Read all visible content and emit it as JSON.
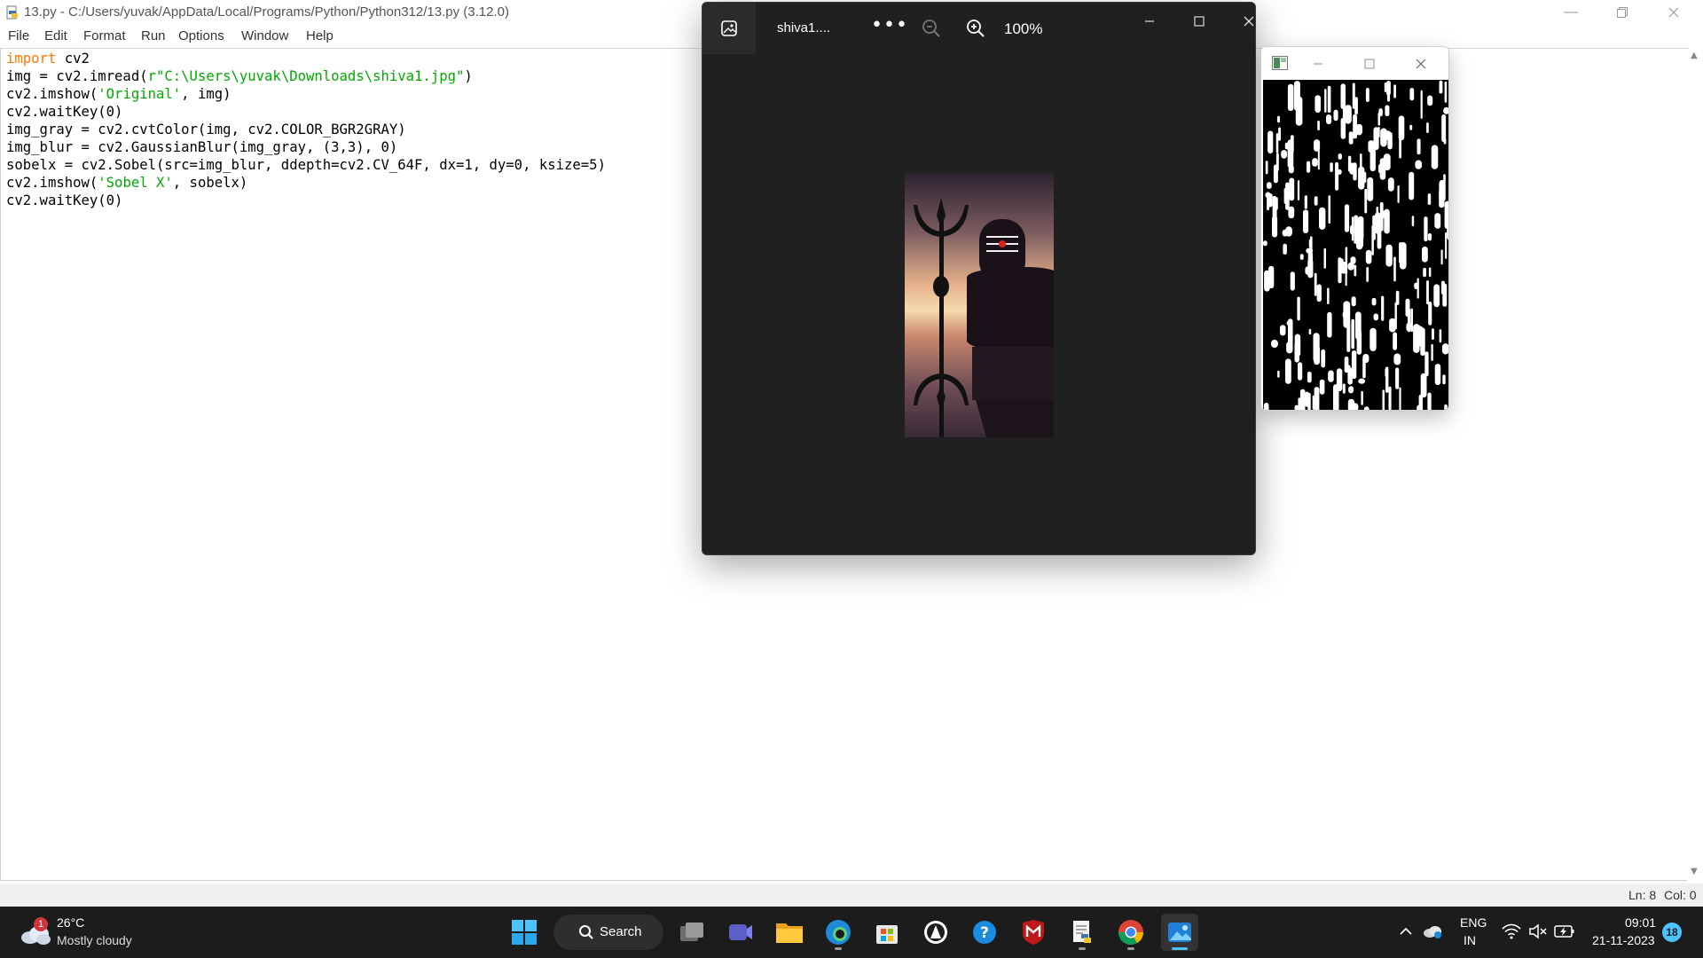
{
  "idle": {
    "title": "13.py - C:/Users/yuvak/AppData/Local/Programs/Python/Python312/13.py (3.12.0)",
    "menu": [
      "File",
      "Edit",
      "Format",
      "Run",
      "Options",
      "Window",
      "Help"
    ],
    "code": [
      [
        {
          "t": "import",
          "c": "kw"
        },
        {
          "t": " cv2",
          "c": ""
        }
      ],
      [
        {
          "t": "img = cv2.imread(",
          "c": ""
        },
        {
          "t": "r\"C:\\Users\\yuvak\\Downloads\\shiva1.jpg\"",
          "c": "st"
        },
        {
          "t": ")",
          "c": ""
        }
      ],
      [
        {
          "t": "cv2.imshow(",
          "c": ""
        },
        {
          "t": "'Original'",
          "c": "st"
        },
        {
          "t": ", img)",
          "c": ""
        }
      ],
      [
        {
          "t": "cv2.waitKey(0)",
          "c": ""
        }
      ],
      [
        {
          "t": "img_gray = cv2.cvtColor(img, cv2.COLOR_BGR2GRAY)",
          "c": ""
        }
      ],
      [
        {
          "t": "img_blur = cv2.GaussianBlur(img_gray, (3,3), 0)",
          "c": ""
        }
      ],
      [
        {
          "t": "sobelx = cv2.Sobel(src=img_blur, ddepth=cv2.CV_64F, dx=1, dy=0, ksize=5)",
          "c": ""
        }
      ],
      [
        {
          "t": "cv2.imshow(",
          "c": ""
        },
        {
          "t": "'Sobel X'",
          "c": "st"
        },
        {
          "t": ", sobelx)",
          "c": ""
        }
      ],
      [
        {
          "t": "cv2.waitKey(0)",
          "c": ""
        }
      ]
    ],
    "status": {
      "line": "Ln: 8",
      "col": "Col: 0"
    }
  },
  "photos": {
    "filename": "shiva1....",
    "zoom": "100%"
  },
  "taskbar": {
    "weather": {
      "temp": "26°C",
      "desc": "Mostly cloudy",
      "badge": "1"
    },
    "search": "Search",
    "apps": [
      "start-icon",
      "task-view-icon",
      "teams-icon",
      "file-explorer-icon",
      "edge-icon",
      "store-icon",
      "app-icon",
      "help-icon",
      "mcafee-icon",
      "idle-icon",
      "chrome-icon",
      "photos-icon"
    ],
    "lang": {
      "l1": "ENG",
      "l2": "IN"
    },
    "clock": {
      "time": "09:01",
      "date": "21-11-2023"
    },
    "notifications": "18"
  },
  "colors": {
    "keyword": "#ff7700",
    "string": "#00aa00",
    "accent": "#4cc2ff",
    "taskbar": "#1c1c1c",
    "photos_bg": "#202020"
  }
}
